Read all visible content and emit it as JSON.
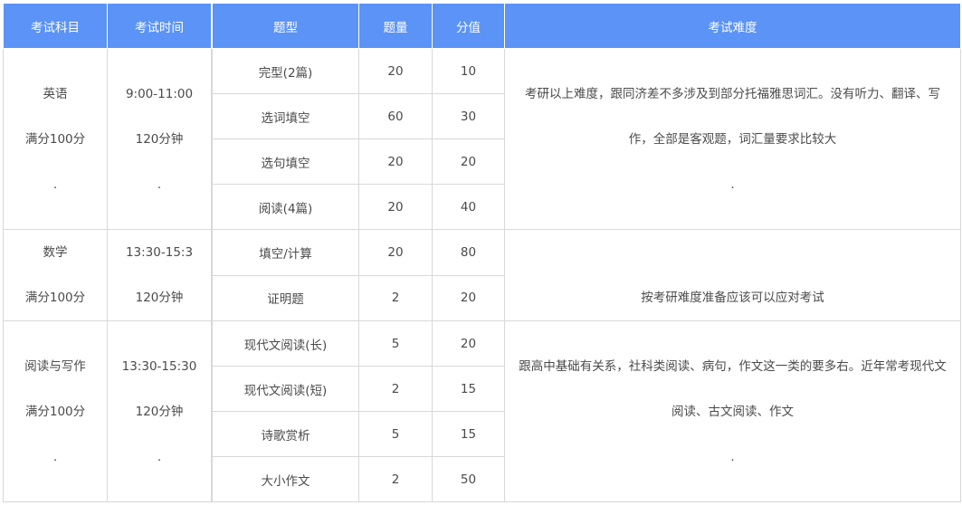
{
  "headers": {
    "subject": "考试科目",
    "time": "考试时间",
    "type": "题型",
    "count": "题量",
    "score": "分值",
    "difficulty": "考试难度"
  },
  "subjects": [
    {
      "name": "英语",
      "full": "满分100分",
      "dot": ".",
      "time": "9:00-11:00",
      "duration": "120分钟",
      "time_dot": "."
    },
    {
      "name": "数学",
      "full": "满分100分",
      "time": "13:30-15:3",
      "duration": "120分钟"
    },
    {
      "name": "阅读与写作",
      "full": "满分100分",
      "dot": ".",
      "time": "13:30-15:30",
      "duration": "120分钟",
      "time_dot": "."
    }
  ],
  "rows": [
    {
      "type": "完型(2篇)",
      "count": "20",
      "score": "10"
    },
    {
      "type": "选词填空",
      "count": "60",
      "score": "30"
    },
    {
      "type": "选句填空",
      "count": "20",
      "score": "20"
    },
    {
      "type": "阅读(4篇)",
      "count": "20",
      "score": "40"
    },
    {
      "type": "填空/计算",
      "count": "20",
      "score": "80"
    },
    {
      "type": "证明题",
      "count": "2",
      "score": "20"
    },
    {
      "type": "现代文阅读(长)",
      "count": "5",
      "score": "20"
    },
    {
      "type": "现代文阅读(短)",
      "count": "2",
      "score": "15"
    },
    {
      "type": "诗歌赏析",
      "count": "5",
      "score": "15"
    },
    {
      "type": "大小作文",
      "count": "2",
      "score": "50"
    }
  ],
  "difficulty": [
    {
      "line1": "考研以上难度，跟同济差不多涉及到部分托福雅思词汇。没有听力、翻译、写",
      "line2": "作，全部是客观题，词汇量要求比较大",
      "line3": "."
    },
    {
      "line1": "",
      "line2": "按考研难度准备应该可以应对考试"
    },
    {
      "line1": "跟高中基础有关系，社科类阅读、病句，作文这一类的要多右。近年常考现代文",
      "line2": "阅读、古文阅读、作文",
      "line3": "."
    }
  ]
}
